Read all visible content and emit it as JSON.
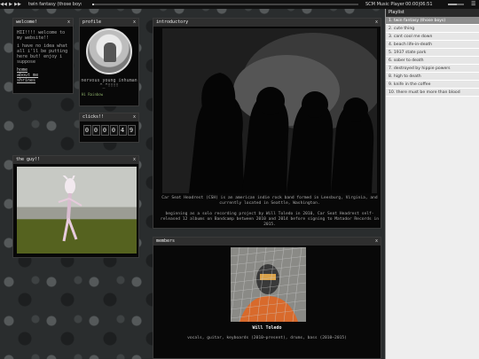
{
  "player": {
    "current_song": "twin fantasy (those boys)",
    "player_name": "SCM Music Player",
    "time": "00:00|06:51",
    "play_icon": "play-icon",
    "prev_icon": "prev-icon",
    "next_icon": "next-icon",
    "menu_icon": "menu-icon"
  },
  "welcome": {
    "title": "welcome!",
    "close": "x",
    "line1": "HII!!!! welcome to my website!!",
    "line2": "i have no idea what all i'll be putting here but! enjoy i suppose",
    "links": [
      "home",
      "about me",
      "shrines"
    ]
  },
  "profile": {
    "title": "profile",
    "close": "x",
    "status": "nervous young inhuman ^_^!!!!",
    "badge": "Hi Rainbow"
  },
  "clicks": {
    "title": "clicks!!",
    "close": "x",
    "digits": [
      "0",
      "0",
      "0",
      "0",
      "4",
      "9"
    ]
  },
  "guy": {
    "title": "the guy!!",
    "close": "x"
  },
  "intro": {
    "title": "introductory",
    "close": "x",
    "para1": "Car Seat Headrest (CSH) is an american indie rock band formed in Leesburg, Virginia, and currently located in Seattle, Washington.",
    "para2": "beginning as a solo recording project by Will Toledo in 2010, Car Seat Headrest self-released 12 albums on Bandcamp between 2010 and 2014 before signing to Matador Records in 2015."
  },
  "members": {
    "title": "members",
    "close": "x",
    "name": "Will Toledo",
    "role": "vocals, guitar, keyboards (2010–present), drums, bass (2010–2015)"
  },
  "playlist": {
    "title": "Playlist",
    "items": [
      "1. twin fantasy (those boys)",
      "2. cute thing",
      "3. cant cool me down",
      "4. beach life-in-death",
      "5. 1937 state park",
      "6. sober to death",
      "7. destroyed by hippie powers",
      "8. high to death",
      "9. knife in the coffee",
      "10. there must be more than blood"
    ],
    "active_index": 0
  },
  "colors": {
    "panel_bg": "#080808",
    "header_bg": "#2f2f2f",
    "playlist_active": "#8c8c8c"
  }
}
